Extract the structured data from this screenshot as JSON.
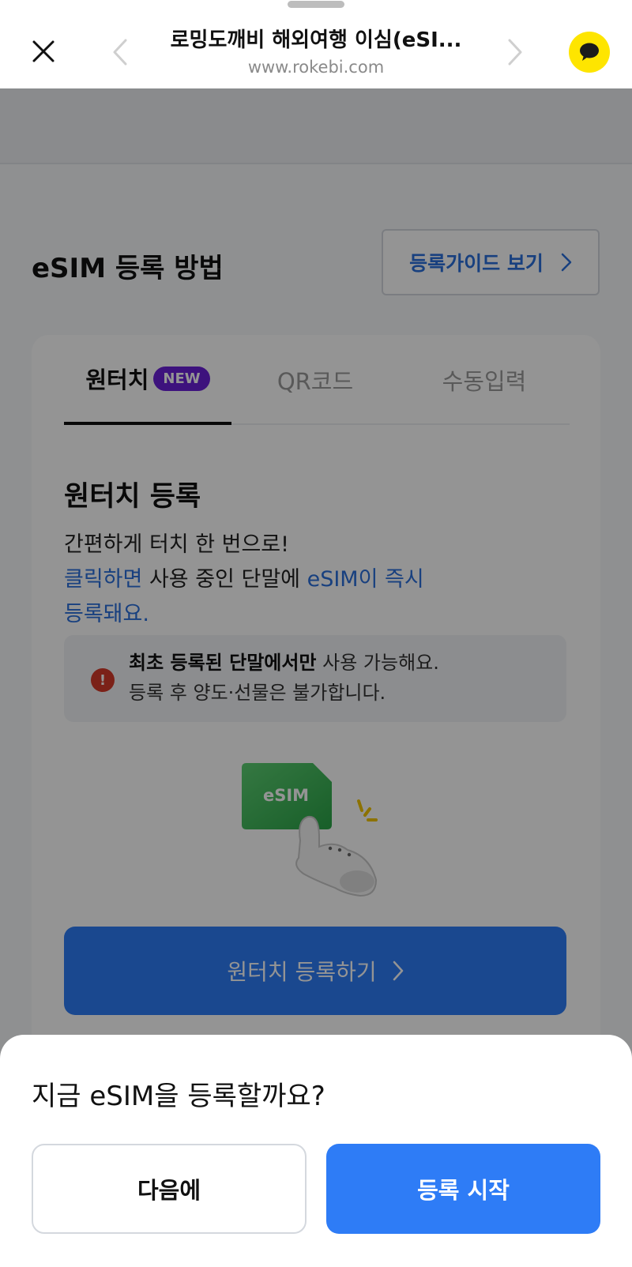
{
  "browser": {
    "title": "로밍도깨비 해외여행 이심(eSI...",
    "url": "www.rokebi.com"
  },
  "section": {
    "title": "eSIM 등록 방법",
    "guide_button": "등록가이드 보기"
  },
  "tabs": [
    {
      "label": "원터치",
      "badge": "NEW",
      "active": true
    },
    {
      "label": "QR코드",
      "active": false
    },
    {
      "label": "수동입력",
      "active": false
    }
  ],
  "onetouch": {
    "heading": "원터치 등록",
    "desc_line1": "간편하게 터치 한 번으로!",
    "desc_line2_blue_a": "클릭하면",
    "desc_line2_plain": " 사용 중인 단말에 ",
    "desc_line2_blue_b": "eSIM이 즉시",
    "desc_line3_blue": "등록돼요.",
    "notice_bold": "최초 등록된 단말에서만",
    "notice_rest": " 사용 가능해요.",
    "notice_line2": "등록 후 양도·선물은 불가합니다.",
    "illustration_label": "eSIM",
    "button_label": "원터치 등록하기"
  },
  "sheet": {
    "question": "지금 eSIM을 등록할까요?",
    "later_label": "다음에",
    "start_label": "등록 시작"
  },
  "colors": {
    "accent": "#2e7cf6",
    "link_blue": "#2a6fdb",
    "new_badge": "#6a1fd8",
    "kakao_yellow": "#fee500",
    "warning_red": "#d53a2a",
    "sim_green": "#3fba5a"
  },
  "icons": {
    "close": "close-icon",
    "prev": "chevron-left-icon",
    "next": "chevron-right-icon",
    "talk": "kakaotalk-icon",
    "warning": "exclamation-icon"
  }
}
